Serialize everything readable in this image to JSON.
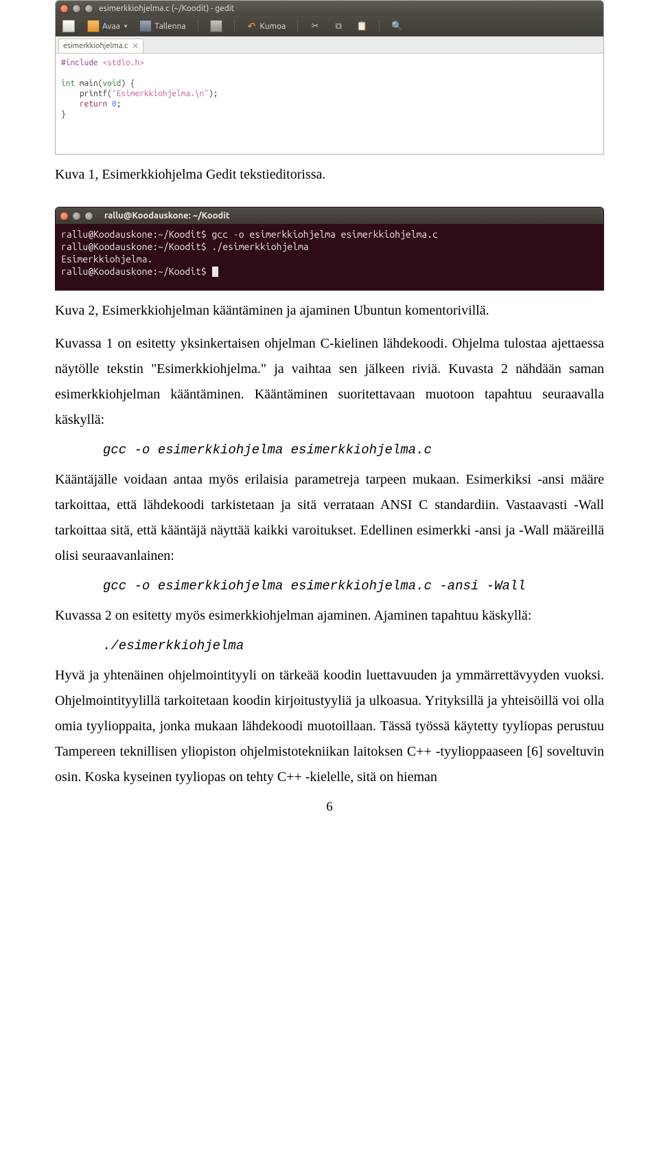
{
  "gedit": {
    "title": "esimerkkiohjelma.c (~/Koodit) - gedit",
    "toolbar": {
      "open": "Avaa",
      "save": "Tallenna",
      "undo": "Kumoa"
    },
    "tab": "esimerkkiohjelma.c",
    "code": {
      "l1a": "#include ",
      "l1b": "<stdio.h>",
      "l2a": "int",
      "l2b": " main(",
      "l2c": "void",
      "l2d": ") {",
      "l3a": "    printf(",
      "l3b": "\"Esimerkkiohjelma.\\n\"",
      "l3c": ");",
      "l4a": "    ",
      "l4b": "return",
      "l4c": " ",
      "l4d": "0",
      "l4e": ";",
      "l5": "}"
    }
  },
  "caption1": "Kuva 1, Esimerkkiohjelma Gedit tekstieditorissa.",
  "terminal": {
    "title": "rallu@Koodauskone: ~/Koodit",
    "lines": [
      "rallu@Koodauskone:~/Koodit$ gcc -o esimerkkiohjelma esimerkkiohjelma.c",
      "rallu@Koodauskone:~/Koodit$ ./esimerkkiohjelma",
      "Esimerkkiohjelma.",
      "rallu@Koodauskone:~/Koodit$ "
    ]
  },
  "caption2": "Kuva 2, Esimerkkiohjelman kääntäminen ja ajaminen Ubuntun komentorivillä.",
  "para1": "Kuvassa 1 on esitetty yksinkertaisen ohjelman C-kielinen lähdekoodi. Ohjelma tulostaa ajettaessa näytölle tekstin \"Esimerkkiohjelma.\" ja vaihtaa sen jälkeen riviä. Kuvasta 2 nähdään saman esimerkkiohjelman kääntäminen. Kääntäminen suoritettavaan muotoon tapahtuu seuraavalla käskyllä:",
  "cmd1": "gcc -o esimerkkiohjelma esimerkkiohjelma.c",
  "para2": "Kääntäjälle voidaan antaa myös erilaisia parametreja tarpeen mukaan. Esimerkiksi -ansi määre tarkoittaa, että lähdekoodi tarkistetaan ja sitä verrataan ANSI C standardiin. Vastaavasti -Wall tarkoittaa sitä, että kääntäjä näyttää kaikki varoitukset. Edellinen esimerkki -ansi ja -Wall määreillä olisi seuraavanlainen:",
  "cmd2": "gcc -o esimerkkiohjelma esimerkkiohjelma.c -ansi -Wall",
  "para3": "Kuvassa 2 on esitetty myös esimerkkiohjelman ajaminen. Ajaminen tapahtuu käskyllä:",
  "cmd3": "./esimerkkiohjelma",
  "para4": "Hyvä ja yhtenäinen ohjelmointityyli on tärkeää koodin luettavuuden ja ymmärrettävyyden vuoksi. Ohjelmointityylillä tarkoitetaan koodin kirjoitustyyliä ja ulkoasua. Yrityksillä ja yhteisöillä voi olla omia tyylioppaita, jonka mukaan lähdekoodi muotoillaan. Tässä työssä käytetty tyyliopas perustuu Tampereen teknillisen yliopiston ohjelmistotekniikan laitoksen C++ -tyylioppaaseen [6] soveltuvin osin. Koska kyseinen tyyliopas on tehty C++ -kielelle, sitä on hieman",
  "pagenum": "6"
}
